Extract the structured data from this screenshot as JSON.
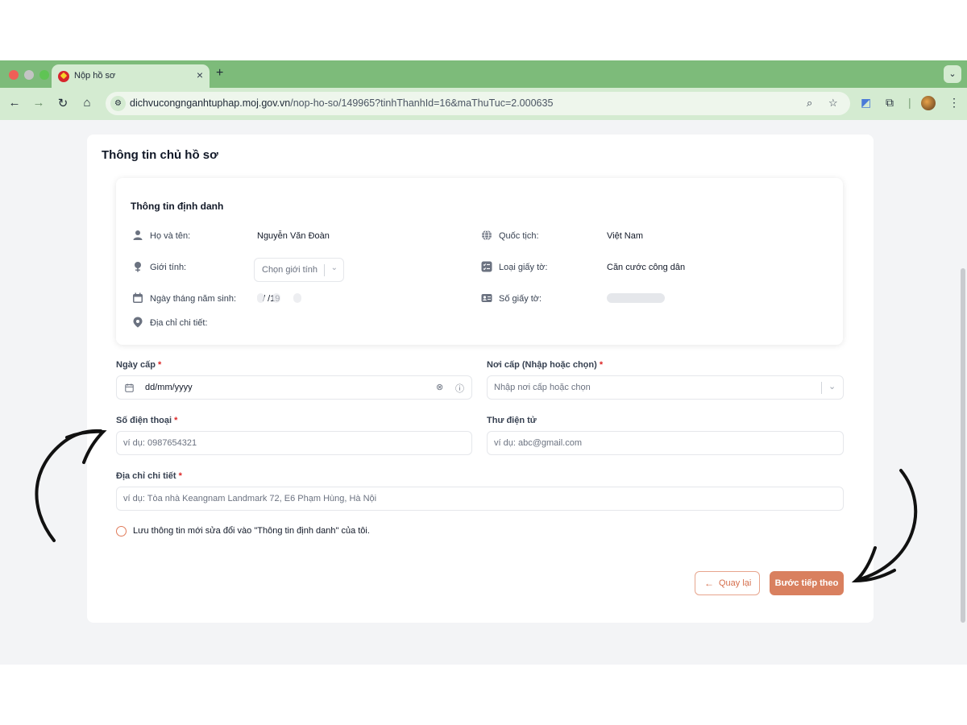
{
  "browser": {
    "tab_title": "Nộp hồ sơ",
    "tab_close": "×",
    "new_tab": "+",
    "tab_menu": "⌄",
    "url_host": "dichvucongnganhtuphap.moj.gov.vn",
    "url_path": "/nop-ho-so/149965?tinhThanhId=16&maThuTuc=2.000635",
    "colors": {
      "frame": "#7dbb7a",
      "toolbar": "#d4ebd1"
    }
  },
  "page": {
    "title": "Thông tin chủ hồ sơ",
    "identity": {
      "title": "Thông tin định danh",
      "full_name_label": "Họ và tên:",
      "full_name_value": "Nguyễn Văn Đoàn",
      "gender_label": "Giới tính:",
      "gender_placeholder": "Chọn giới tính",
      "dob_label": "Ngày tháng năm sinh:",
      "dob_value": "/ /19",
      "address_label": "Địa chỉ chi tiết:",
      "nationality_label": "Quốc tịch:",
      "nationality_value": "Việt Nam",
      "doc_type_label": "Loại giấy tờ:",
      "doc_type_value": "Căn cước công dân",
      "doc_number_label": "Số giấy tờ:"
    },
    "form": {
      "issue_date_label": "Ngày cấp",
      "issue_date_value": "dd/mm/yyyy",
      "issue_place_label": "Nơi cấp (Nhập hoặc chọn)",
      "issue_place_placeholder": "Nhập nơi cấp hoặc chọn",
      "phone_label": "Số điện thoại",
      "phone_placeholder": "ví dụ: 0987654321",
      "email_label": "Thư điện tử",
      "email_placeholder": "ví dụ: abc@gmail.com",
      "address_label": "Địa chỉ chi tiết",
      "address_placeholder": "ví dụ: Tòa nhà Keangnam Landmark 72, E6 Phạm Hùng, Hà Nội",
      "required_mark": "*",
      "save_checkbox_label": "Lưu thông tin mới sửa đổi vào \"Thông tin định danh\" của tôi."
    },
    "buttons": {
      "back": "Quay lại",
      "next": "Bước tiếp theo"
    },
    "colors": {
      "accent": "#d9805f",
      "required": "#dc2626"
    }
  }
}
